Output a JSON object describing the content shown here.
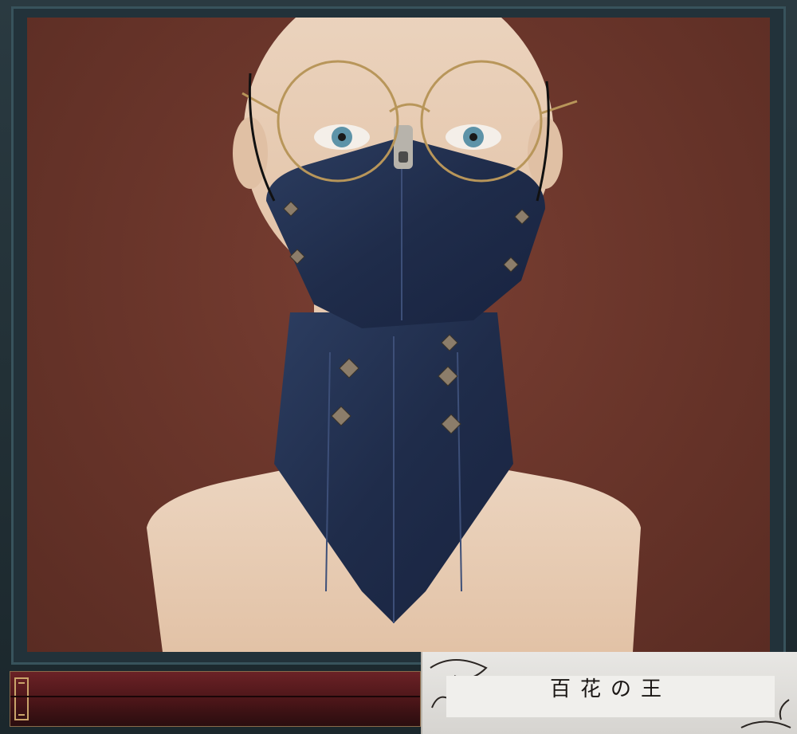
{
  "label": {
    "text": "百花の王"
  },
  "colors": {
    "background": "#6b362b",
    "frame": "#22323a",
    "mask": "#1f2c4a",
    "panel": "#e8e7e4",
    "bar": "#4a1518"
  }
}
